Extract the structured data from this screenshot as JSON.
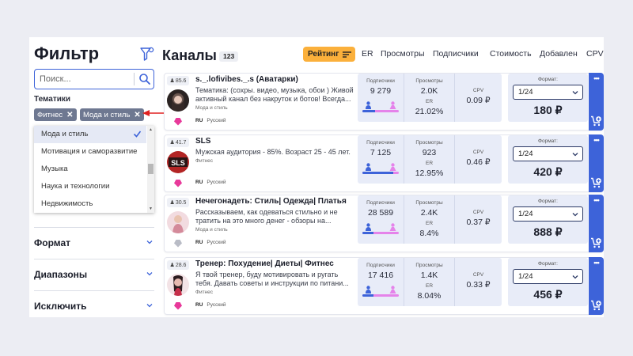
{
  "sidebar": {
    "title": "Фильтр",
    "search_placeholder": "Поиск...",
    "topics_label": "Тематики",
    "chips": [
      "Фитнес",
      "Мода и стиль"
    ],
    "dropdown_items": [
      {
        "label": "Мода и стиль",
        "selected": true
      },
      {
        "label": "Мотивация и саморазвитие",
        "selected": false
      },
      {
        "label": "Музыка",
        "selected": false
      },
      {
        "label": "Наука и технологии",
        "selected": false
      },
      {
        "label": "Недвижимость",
        "selected": false
      }
    ],
    "sections": [
      "Формат",
      "Диапазоны",
      "Исключить"
    ]
  },
  "main": {
    "title": "Каналы",
    "count": "123",
    "rating_label": "Рейтинг",
    "sort_links": [
      "ER",
      "Просмотры",
      "Подписчики",
      "Стоимость",
      "Добавлен",
      "CPV"
    ]
  },
  "labels": {
    "subscribers": "Подписчики",
    "views": "Просмотры",
    "er": "ER",
    "cpv": "CPV",
    "format": "Формат:"
  },
  "channels": [
    {
      "badge": "85.6",
      "name": "s._.lofivibes._.s (Аватарки)",
      "description": "Тематика: (сохры. видео, музыка, обои ) Живой активный канал без накруток и ботов! Всегда...",
      "category": "Мода и стиль",
      "lang_code": "RU",
      "language": "Русский",
      "subscribers": "9 279",
      "views": "2.0K",
      "er": "21.02%",
      "cpv": "0.09 ₽",
      "male_share": 0.35,
      "format": "1/24",
      "price": "180 ₽",
      "favorite": true
    },
    {
      "badge": "41.7",
      "name": "SLS",
      "description": "Мужская аудитория - 85%. Возраст 25 - 45 лет.",
      "category": "Фитнес",
      "lang_code": "RU",
      "language": "Русский",
      "subscribers": "7 125",
      "views": "923",
      "er": "12.95%",
      "cpv": "0.46 ₽",
      "male_share": 0.85,
      "format": "1/24",
      "price": "420 ₽",
      "favorite": true
    },
    {
      "badge": "30.5",
      "name": "Нечегонадеть: Стиль| Одежда| Платья",
      "description": "Рассказываем, как одеваться стильно и не тратить на это много денег - обзоры на...",
      "category": "Мода и стиль",
      "lang_code": "RU",
      "language": "Русский",
      "subscribers": "28 589",
      "views": "2.4K",
      "er": "8.4%",
      "cpv": "0.37 ₽",
      "male_share": 0.3,
      "format": "1/24",
      "price": "888 ₽",
      "favorite": false
    },
    {
      "badge": "28.6",
      "name": "Тренер: Похудение| Диеты| Фитнес",
      "description": "Я твой тренер, буду мотивировать и ругать тебя. Давать советы и инструкции по питани...",
      "category": "Фитнес",
      "lang_code": "RU",
      "language": "Русский",
      "subscribers": "17 416",
      "views": "1.4K",
      "er": "8.04%",
      "cpv": "0.33 ₽",
      "male_share": 0.3,
      "format": "1/24",
      "price": "456 ₽",
      "favorite": true
    }
  ],
  "colors": {
    "accent": "#3d63d9",
    "rating": "#fbb03b",
    "heart": "#e8399a",
    "female": "#e583ea",
    "panel": "#e8ecf8"
  }
}
